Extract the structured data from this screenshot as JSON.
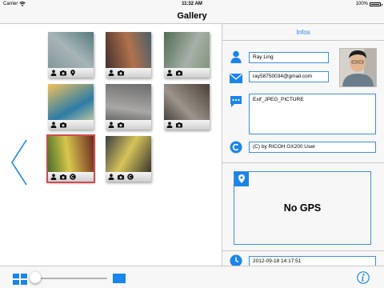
{
  "status_bar": {
    "carrier": "Carrier",
    "time": "11:32 AM",
    "battery": "100%",
    "battery_level": 1.0
  },
  "nav": {
    "title": "Gallery"
  },
  "gallery": {
    "thumbnails": [
      {
        "id": "t1",
        "bar_icons": [
          "person-icon",
          "camera-icon",
          "location-pin-icon"
        ],
        "selected": false,
        "colors": [
          "#7d8f96",
          "#a6b5b7",
          "#587a7c"
        ]
      },
      {
        "id": "t2",
        "bar_icons": [
          "person-icon",
          "camera-icon"
        ],
        "selected": false,
        "colors": [
          "#3c2a2c",
          "#b0714c",
          "#4a5f6e"
        ]
      },
      {
        "id": "t3",
        "bar_icons": [
          "person-icon",
          "camera-icon"
        ],
        "selected": false,
        "colors": [
          "#4f6c54",
          "#a8b0a8",
          "#7a8f76"
        ]
      },
      {
        "id": "t4",
        "bar_icons": [
          "person-icon",
          "camera-icon"
        ],
        "selected": false,
        "colors": [
          "#f1c35b",
          "#2c7ca7",
          "#f3e0a0"
        ]
      },
      {
        "id": "t5",
        "bar_icons": [
          "person-icon",
          "camera-icon"
        ],
        "selected": false,
        "colors": [
          "#6d6c6c",
          "#a8a7a6",
          "#3f3f3f"
        ]
      },
      {
        "id": "t6",
        "bar_icons": [
          "person-icon",
          "camera-icon"
        ],
        "selected": false,
        "colors": [
          "#4a3f38",
          "#9d948b",
          "#2d2825"
        ]
      },
      {
        "id": "t7",
        "bar_icons": [
          "person-icon",
          "camera-icon",
          "copyright-icon"
        ],
        "selected": true,
        "colors": [
          "#6a2a22",
          "#d8c64c",
          "#3e6a26"
        ]
      },
      {
        "id": "t8",
        "bar_icons": [
          "person-icon",
          "camera-icon",
          "copyright-icon"
        ],
        "selected": false,
        "colors": [
          "#1f2026",
          "#d6c35a",
          "#3a3c44"
        ]
      }
    ]
  },
  "infos": {
    "header": "Infos",
    "name": "Ray Ling",
    "email": "ray58750034@gmail.com",
    "comment": "Exif_JPEG_PICTURE",
    "copyright": "(C) by RICOH GX200 User",
    "gps_label": "No GPS",
    "date": "2012-09-18 14:17:51"
  },
  "toolbar": {
    "thumb_size_level": 0.0
  },
  "colors": {
    "accent": "#1a85ea",
    "field_border": "#3d8fe4",
    "selected_border": "#d9474b"
  }
}
